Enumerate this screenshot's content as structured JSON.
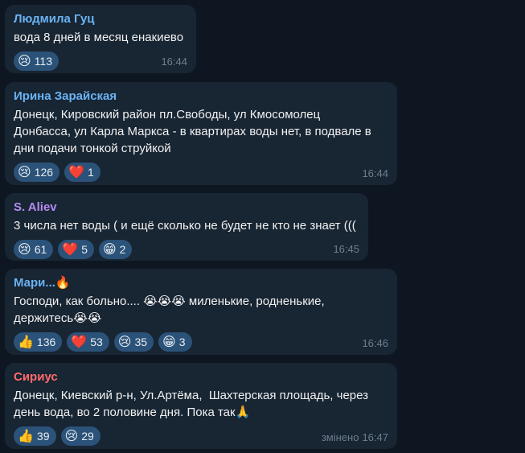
{
  "messages": [
    {
      "author": "Людмила Гуц",
      "author_color": "#6ab3f3",
      "text": "вода 8 дней в месяц енакиево",
      "reactions": [
        {
          "emoji": "😢",
          "icon": "crying-face-icon",
          "count": "113"
        }
      ],
      "time": "16:44"
    },
    {
      "author": "Ирина Зарайская",
      "author_color": "#6ab3f3",
      "text": "Донецк, Кировский район пл.Свободы, ул Кмосомолец\nДонбасса, ул Карла Маркса - в квартирах воды нет, в подвале в\nдни подачи тонкой струйкой",
      "reactions": [
        {
          "emoji": "😢",
          "icon": "crying-face-icon",
          "count": "126"
        },
        {
          "emoji": "❤️",
          "icon": "heart-icon",
          "count": "1"
        }
      ],
      "time": "16:44"
    },
    {
      "author": "S. Aliev",
      "author_color": "#b48bf2",
      "text": "3 числа нет воды ( и ещё сколько не будет не кто не знает (((",
      "reactions": [
        {
          "emoji": "😢",
          "icon": "crying-face-icon",
          "count": "61"
        },
        {
          "emoji": "❤️",
          "icon": "heart-icon",
          "count": "5"
        },
        {
          "emoji": "😁",
          "icon": "grinning-face-icon",
          "count": "2"
        }
      ],
      "time": "16:45"
    },
    {
      "author": "Мари...🔥",
      "author_color": "#6ab3f3",
      "text": "Господи, как больно.... 😭😭😭 миленькие, родненькие,\nдержитесь😭😭",
      "reactions": [
        {
          "emoji": "👍",
          "icon": "thumbs-up-icon",
          "count": "136"
        },
        {
          "emoji": "❤️",
          "icon": "heart-icon",
          "count": "53"
        },
        {
          "emoji": "😢",
          "icon": "crying-face-icon",
          "count": "35"
        },
        {
          "emoji": "😁",
          "icon": "grinning-face-icon",
          "count": "3"
        }
      ],
      "time": "16:46"
    },
    {
      "author": "Сириус",
      "author_color": "#ff6b6b",
      "text": "Донецк, Киевский р-н, Ул.Артёма,  Шахтерская площадь, через\nдень вода, во 2 половине дня. Пока так🙏",
      "reactions": [
        {
          "emoji": "👍",
          "icon": "thumbs-up-icon",
          "count": "39"
        },
        {
          "emoji": "😢",
          "icon": "crying-face-icon",
          "count": "29"
        }
      ],
      "edited": "змінено",
      "time": "16:47"
    }
  ]
}
